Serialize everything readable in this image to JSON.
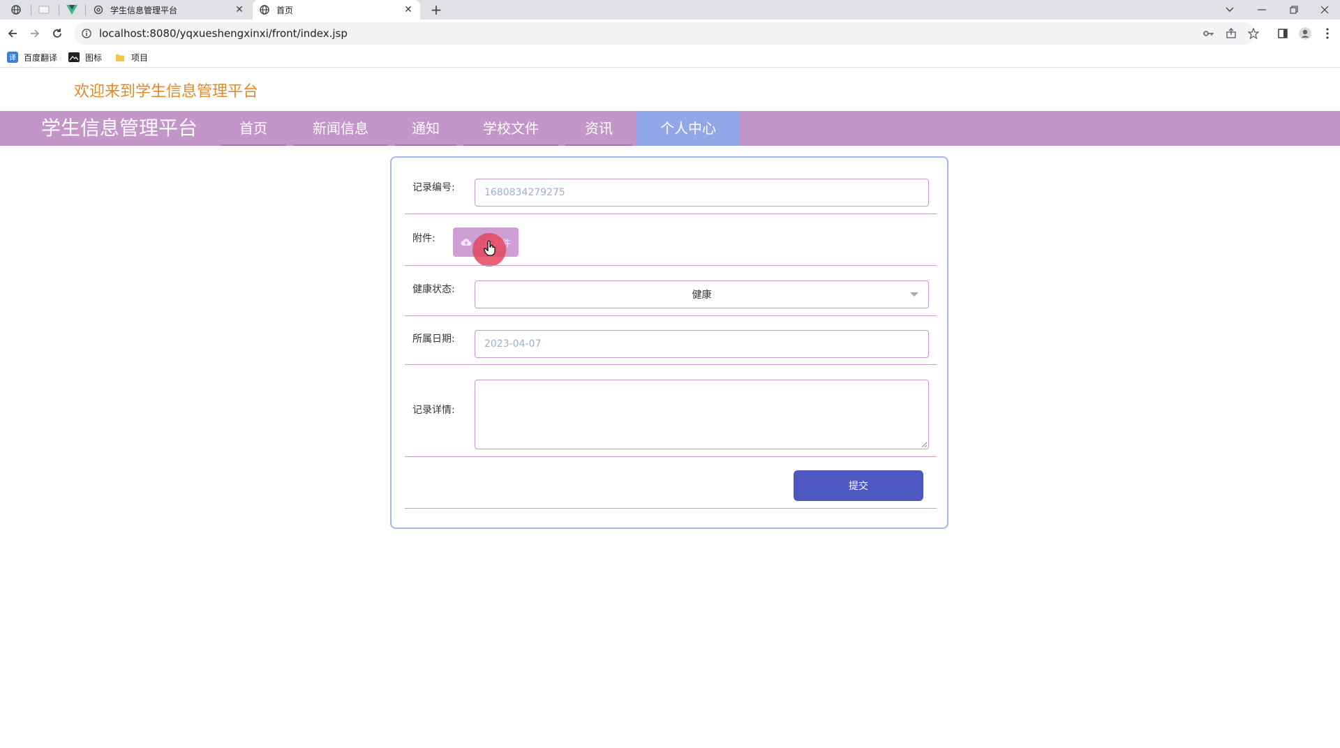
{
  "browser": {
    "tabs": [
      {
        "title": "学生信息管理平台",
        "active": false
      },
      {
        "title": "首页",
        "active": true
      }
    ],
    "url": "localhost:8080/yqxueshengxinxi/front/index.jsp",
    "bookmarks": [
      "百度翻译",
      "图标",
      "项目"
    ]
  },
  "header": {
    "welcome": "欢迎来到学生信息管理平台",
    "brand": "学生信息管理平台",
    "nav": [
      "首页",
      "新闻信息",
      "通知",
      "学校文件",
      "资讯",
      "个人中心"
    ],
    "active_nav": "个人中心"
  },
  "form": {
    "record_no_label": "记录编号:",
    "record_no_value": "1680834279275",
    "attachment_label": "附件:",
    "upload_label": "上传附件",
    "health_label": "健康状态:",
    "health_value": "健康",
    "date_label": "所属日期:",
    "date_value": "2023-04-07",
    "detail_label": "记录详情:",
    "detail_value": "",
    "submit_label": "提交"
  },
  "colors": {
    "navbar": "#c395c8",
    "nav_active": "#92a7e8",
    "welcome": "#e08a2c",
    "submit": "#4f58c0",
    "upload": "#ce9ed5"
  }
}
